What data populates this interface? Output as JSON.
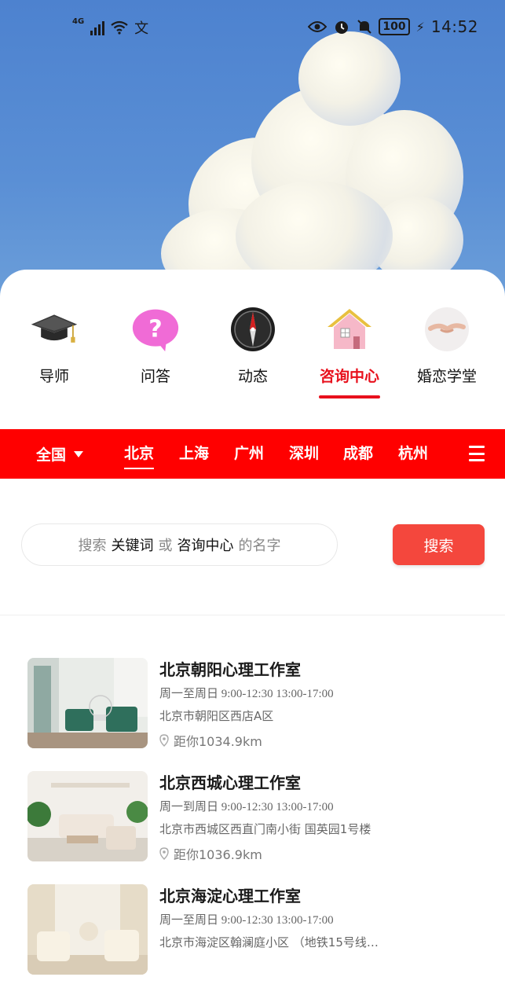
{
  "status_bar": {
    "network": "4G",
    "wifi_label": "文",
    "battery": "100",
    "time": "14:52"
  },
  "categories": [
    {
      "label": "导师",
      "icon": "graduation-cap-icon"
    },
    {
      "label": "问答",
      "icon": "question-bubble-icon"
    },
    {
      "label": "动态",
      "icon": "compass-icon"
    },
    {
      "label": "咨询中心",
      "icon": "house-icon",
      "active": true
    },
    {
      "label": "婚恋学堂",
      "icon": "holding-hands-icon"
    }
  ],
  "city_bar": {
    "national": "全国",
    "cities": [
      "北京",
      "上海",
      "广州",
      "深圳",
      "成都",
      "杭州"
    ],
    "active_city": "北京"
  },
  "search": {
    "prefix": "搜索",
    "keyword1": "关键词",
    "or": "或",
    "keyword2": "咨询中心",
    "suffix": "的名字",
    "button": "搜索"
  },
  "centers": [
    {
      "name": "北京朝阳心理工作室",
      "days": "周一至周日",
      "time": "9:00-12:30 13:00-17:00",
      "address": "北京市朝阳区西店A区",
      "distance": "距你1034.9km"
    },
    {
      "name": "北京西城心理工作室",
      "days": "周一到周日",
      "time": "9:00-12:30 13:00-17:00",
      "address": "北京市西城区西直门南小街 国英园1号楼",
      "distance": "距你1036.9km"
    },
    {
      "name": "北京海淀心理工作室",
      "days": "周一至周日",
      "time": "9:00-12:30 13:00-17:00",
      "address": "北京市海淀区翰澜庭小区 （地铁15号线…",
      "distance": ""
    }
  ],
  "colors": {
    "brand_red": "#ff0000",
    "active_red": "#e8101c",
    "search_button": "#f4473d",
    "sky": "#5a8fd5"
  }
}
